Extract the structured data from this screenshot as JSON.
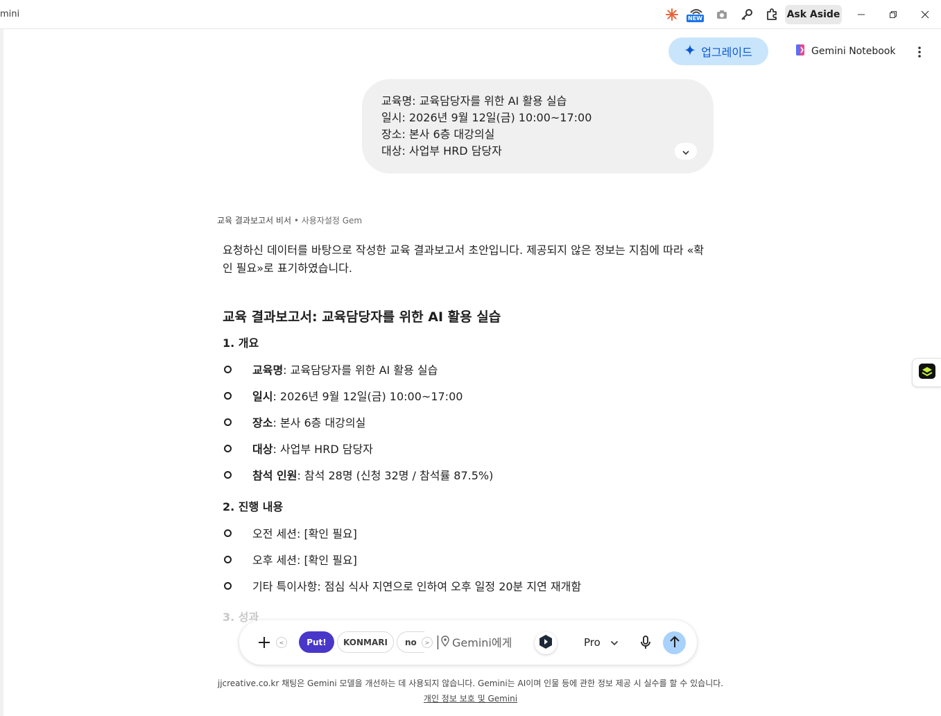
{
  "window": {
    "title": "mini",
    "new_badge": "NEW",
    "ask_aside": "Ask Aside",
    "icons": [
      "spark-extension-icon",
      "wifi-new-icon",
      "camera-icon",
      "key-icon",
      "puzzle-extension-icon",
      "minimize-icon",
      "maximize-icon",
      "close-icon"
    ]
  },
  "header": {
    "upgrade_label": "업그레이드",
    "notebook_label": "Gemini Notebook",
    "accent": "#0b57d0",
    "upgrade_bg": "#c9e5fb"
  },
  "user_message": {
    "lines": [
      "교육명: 교육담당자를 위한 AI 활용 실습",
      "일시: 2026년 9월 12일(금) 10:00~17:00",
      "장소: 본사 6층 대강의실",
      "대상: 사업부 HRD 담당자"
    ]
  },
  "response": {
    "gem_name": "교육 결과보고서 비서",
    "gem_sep": " • ",
    "gem_type": "사용자설정 Gem",
    "intro": "요청하신 데이터를 바탕으로 작성한 교육 결과보고서 초안입니다. 제공되지 않은 정보는 지침에 따라 «확인 필요»로 표기하였습니다.",
    "title": "교육 결과보고서: 교육담당자를 위한 AI 활용 실습",
    "section1": {
      "heading": "1. 개요",
      "items": [
        {
          "label": "교육명",
          "value": ": 교육담당자를 위한 AI 활용 실습"
        },
        {
          "label": "일시",
          "value": ": 2026년 9월 12일(금) 10:00~17:00"
        },
        {
          "label": "장소",
          "value": ": 본사 6층 대강의실"
        },
        {
          "label": "대상",
          "value": ": 사업부 HRD 담당자"
        },
        {
          "label": "참석 인원",
          "value": ": 참석 28명 (신청 32명 / 참석률 87.5%)"
        }
      ]
    },
    "section2": {
      "heading": "2. 진행 내용",
      "items": [
        "오전 세션: [확인 필요]",
        "오후 세션: [확인 필요]",
        "기타 특이사항: 점심 식사 지연으로 인하여 오후 일정 20분 지연 재개함"
      ]
    },
    "section3_heading": "3. 성과"
  },
  "composer": {
    "prev_arrow": "<",
    "next_arrow": ">",
    "chips": [
      "Put!",
      "KONMARI",
      "no"
    ],
    "placeholder": "Gemini에게",
    "model": "Pro",
    "put_color": "#4937c9",
    "send_color": "#a8d1fb"
  },
  "footer": {
    "disclaimer": "jjcreative.co.kr 채팅은 Gemini 모델을 개선하는 데 사용되지 않습니다. Gemini는 AI이며 인물 등에 관한 정보 제공 시 실수를 할 수 있습니다.",
    "privacy_link": "개인 정보 보호 및 Gemini"
  }
}
